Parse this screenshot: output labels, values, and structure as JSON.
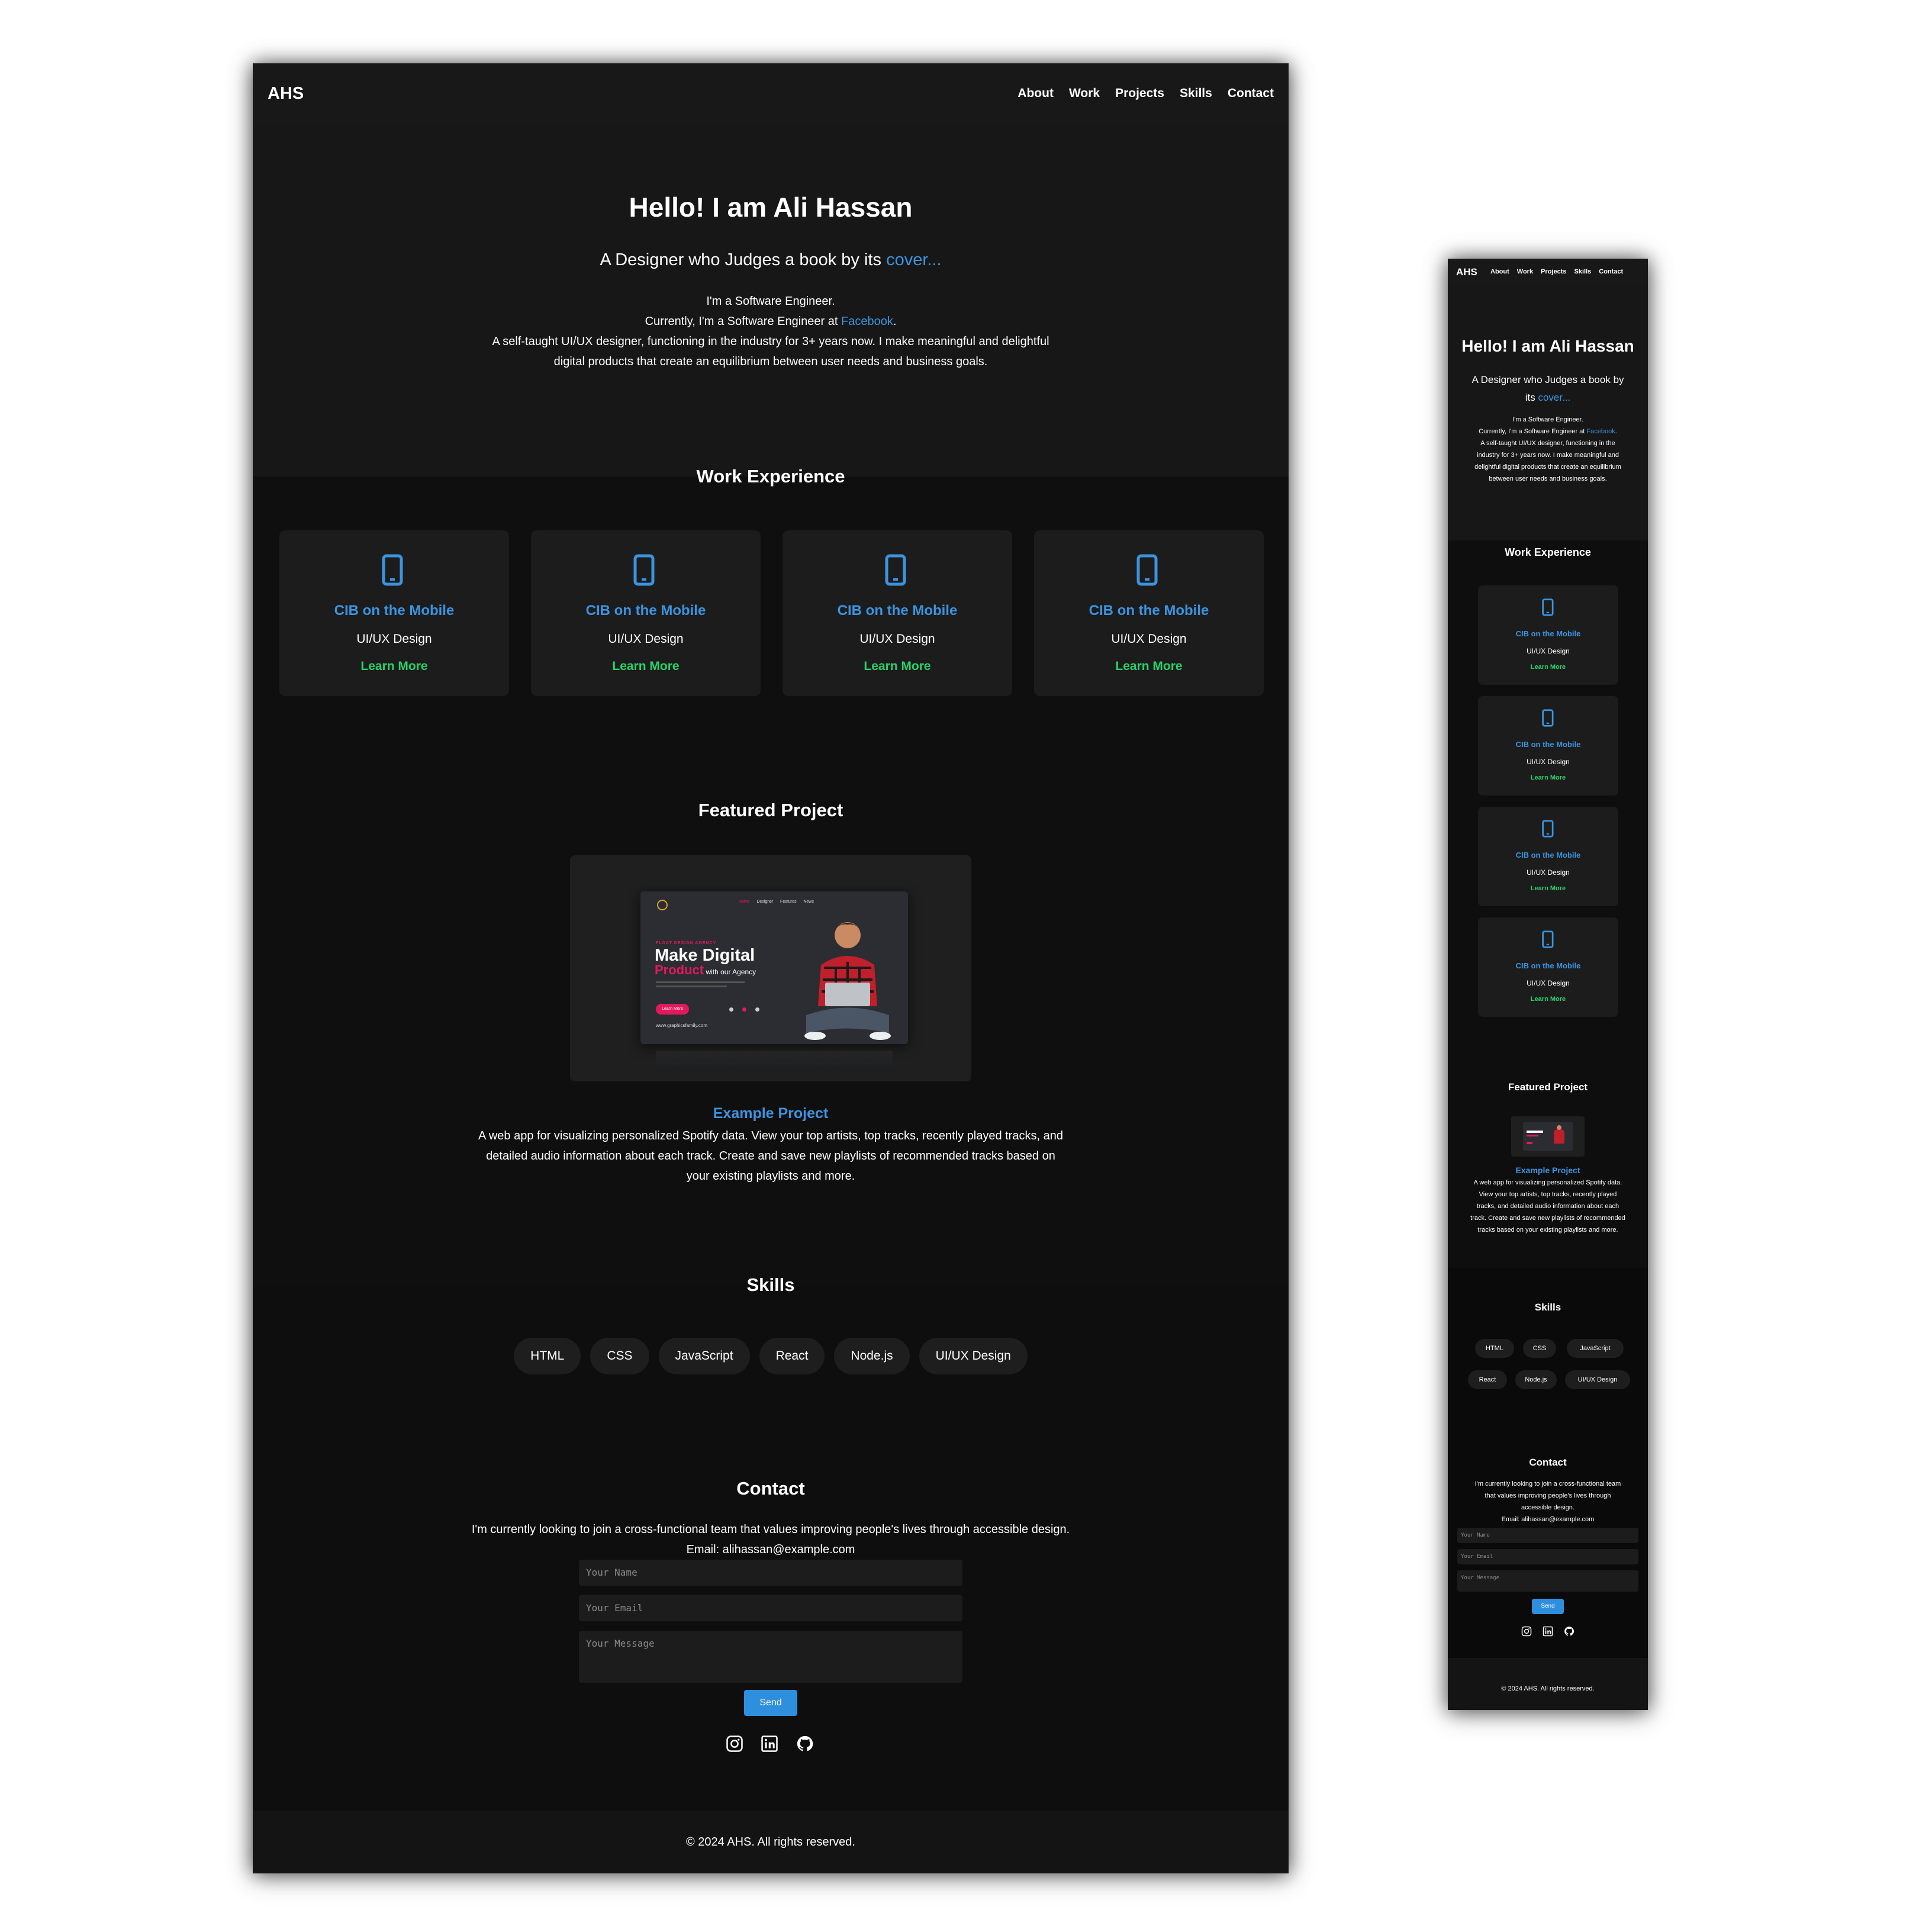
{
  "site": {
    "logo": "AHS",
    "nav": [
      "About",
      "Work",
      "Projects",
      "Skills",
      "Contact"
    ]
  },
  "hero": {
    "title": "Hello! I am Ali Hassan",
    "tagline_pre": "A Designer who Judges a book by its ",
    "tagline_link": "cover...",
    "tagline_pre_m1": "A Designer who Judges a book by",
    "tagline_pre_m2": "its ",
    "line1": "I'm a Software Engineer.",
    "line2_pre": "Currently, I'm a Software Engineer at ",
    "line2_link": "Facebook",
    "line2_post": ".",
    "line3a": "A self-taught UI/UX designer, functioning in the industry for 3+ years now. I make meaningful and delightful",
    "line3b": "digital products that create an equilibrium between user needs and business goals.",
    "m_line3a": "A self-taught UI/UX designer, functioning in the",
    "m_line3b": "industry for 3+ years now. I make meaningful and",
    "m_line3c": "delightful digital products that create an equilibrium",
    "m_line3d": "between user needs and business goals."
  },
  "work": {
    "heading": "Work Experience",
    "cards": [
      {
        "title": "CIB on the Mobile",
        "subtitle": "UI/UX Design",
        "link": "Learn More"
      },
      {
        "title": "CIB on the Mobile",
        "subtitle": "UI/UX Design",
        "link": "Learn More"
      },
      {
        "title": "CIB on the Mobile",
        "subtitle": "UI/UX Design",
        "link": "Learn More"
      },
      {
        "title": "CIB on the Mobile",
        "subtitle": "UI/UX Design",
        "link": "Learn More"
      }
    ]
  },
  "featured": {
    "heading": "Featured Project",
    "project_title": "Example Project",
    "desc_a": "A web app for visualizing personalized Spotify data. View your top artists, top tracks, recently played tracks, and",
    "desc_b": "detailed audio information about each track. Create and save new playlists of recommended tracks based on",
    "desc_c": "your existing playlists and more.",
    "m_desc": [
      "A web app for visualizing personalized Spotify data.",
      "View your top artists, top tracks, recently played",
      "tracks, and detailed audio information about each",
      "track. Create and save new playlists of recommended",
      "tracks based on your existing playlists and more."
    ],
    "mock": {
      "nav": [
        "Home",
        "Designer",
        "Features",
        "News"
      ],
      "kicker": "FLOAT DESIGN AGENCY",
      "headline1": "Make Digital",
      "headline2": "Product",
      "headline2b": " with our Agency",
      "button": "Learn More",
      "url": "www.graphicsfamily.com"
    }
  },
  "skills": {
    "heading": "Skills",
    "items": [
      "HTML",
      "CSS",
      "JavaScript",
      "React",
      "Node.js",
      "UI/UX Design"
    ]
  },
  "contact": {
    "heading": "Contact",
    "text": "I'm currently looking to join a cross-functional team that values improving people's lives through accessible design.",
    "m_text": [
      "I'm currently looking to join a cross-functional team",
      "that values improving people's lives through",
      "accessible design."
    ],
    "email": "Email: alihassan@example.com",
    "name_placeholder": "Your Name",
    "email_placeholder": "Your Email",
    "message_placeholder": "Your Message",
    "send": "Send",
    "social": [
      "instagram-icon",
      "linkedin-icon",
      "github-icon"
    ]
  },
  "footer": {
    "text": "© 2024 AHS. All rights reserved."
  },
  "colors": {
    "accent_blue": "#3b94e0",
    "accent_green": "#26d36a",
    "background": "#0e0e0e",
    "card": "#1c1c1c"
  }
}
